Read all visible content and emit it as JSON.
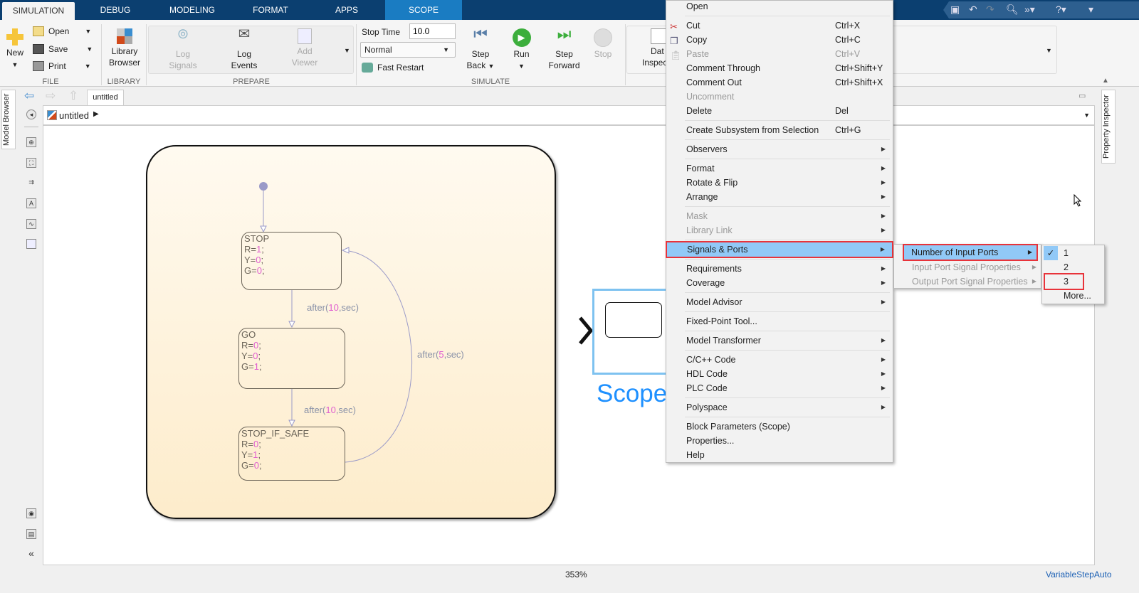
{
  "tabs": [
    {
      "label": "SIMULATION",
      "active": true
    },
    {
      "label": "DEBUG"
    },
    {
      "label": "MODELING"
    },
    {
      "label": "FORMAT"
    },
    {
      "label": "APPS"
    },
    {
      "label": "SCOPE",
      "contextual": true
    }
  ],
  "toolstrip": {
    "file": {
      "label": "FILE",
      "new": "New",
      "open": "Open",
      "save": "Save",
      "print": "Print"
    },
    "library": {
      "label": "LIBRARY",
      "browser_line1": "Library",
      "browser_line2": "Browser"
    },
    "prepare": {
      "label": "PREPARE",
      "log_signals": [
        "Log",
        "Signals"
      ],
      "log_events": [
        "Log",
        "Events"
      ],
      "add_viewer": [
        "Add",
        "Viewer"
      ]
    },
    "simulate": {
      "label": "SIMULATE",
      "stop_time_label": "Stop Time",
      "stop_time_value": "10.0",
      "mode": "Normal",
      "fast_restart": "Fast Restart",
      "step_back": [
        "Step",
        "Back"
      ],
      "run": "Run",
      "step_forward": [
        "Step",
        "Forward"
      ],
      "stop": "Stop"
    },
    "review": {
      "data_inspector": [
        "Dat",
        "Inspec"
      ]
    }
  },
  "nav": {
    "tab": "untitled",
    "breadcrumb": "untitled"
  },
  "side": {
    "model_browser": "Model Browser",
    "property_inspector": "Property Inspector"
  },
  "chart": {
    "states": [
      {
        "name": "STOP",
        "lines": [
          [
            "R=",
            "1",
            ";"
          ],
          [
            "Y=",
            "0",
            ";"
          ],
          [
            "G=",
            "0",
            ";"
          ]
        ]
      },
      {
        "name": "GO",
        "lines": [
          [
            "R=",
            "0",
            ";"
          ],
          [
            "Y=",
            "0",
            ";"
          ],
          [
            "G=",
            "1",
            ";"
          ]
        ]
      },
      {
        "name": "STOP_IF_SAFE",
        "lines": [
          [
            "R=",
            "0",
            ";"
          ],
          [
            "Y=",
            "1",
            ";"
          ],
          [
            "G=",
            "0",
            ";"
          ]
        ]
      }
    ],
    "transitions": [
      [
        "after(",
        "10",
        ",sec)"
      ],
      [
        "after(",
        "10",
        ",sec)"
      ],
      [
        "after(",
        "5",
        ",sec)"
      ]
    ]
  },
  "scope_label": "Scope",
  "context_menu": [
    {
      "label": "Open"
    },
    {
      "sep": true
    },
    {
      "label": "Cut",
      "shortcut": "Ctrl+X",
      "icon": "scissors-icon"
    },
    {
      "label": "Copy",
      "shortcut": "Ctrl+C",
      "icon": "copy-icon"
    },
    {
      "label": "Paste",
      "shortcut": "Ctrl+V",
      "icon": "paste-icon",
      "disabled": true
    },
    {
      "label": "Comment Through",
      "shortcut": "Ctrl+Shift+Y"
    },
    {
      "label": "Comment Out",
      "shortcut": "Ctrl+Shift+X"
    },
    {
      "label": "Uncomment",
      "disabled": true
    },
    {
      "label": "Delete",
      "shortcut": "Del"
    },
    {
      "sep": true
    },
    {
      "label": "Create Subsystem from Selection",
      "shortcut": "Ctrl+G"
    },
    {
      "sep": true
    },
    {
      "label": "Observers",
      "submenu": true
    },
    {
      "sep": true
    },
    {
      "label": "Format",
      "submenu": true
    },
    {
      "label": "Rotate & Flip",
      "submenu": true
    },
    {
      "label": "Arrange",
      "submenu": true
    },
    {
      "sep": true
    },
    {
      "label": "Mask",
      "submenu": true,
      "disabled": true
    },
    {
      "label": "Library Link",
      "submenu": true,
      "disabled": true
    },
    {
      "sep": true
    },
    {
      "label": "Signals & Ports",
      "submenu": true,
      "highlighted": true
    },
    {
      "sep": true
    },
    {
      "label": "Requirements",
      "submenu": true
    },
    {
      "label": "Coverage",
      "submenu": true
    },
    {
      "sep": true
    },
    {
      "label": "Model Advisor",
      "submenu": true
    },
    {
      "sep": true
    },
    {
      "label": "Fixed-Point Tool..."
    },
    {
      "sep": true
    },
    {
      "label": "Model Transformer",
      "submenu": true
    },
    {
      "sep": true
    },
    {
      "label": "C/C++ Code",
      "submenu": true
    },
    {
      "label": "HDL Code",
      "submenu": true
    },
    {
      "label": "PLC Code",
      "submenu": true
    },
    {
      "sep": true
    },
    {
      "label": "Polyspace",
      "submenu": true
    },
    {
      "sep": true
    },
    {
      "label": "Block Parameters (Scope)"
    },
    {
      "label": "Properties..."
    },
    {
      "label": "Help"
    }
  ],
  "submenu": [
    {
      "label": "Number of Input Ports",
      "highlighted": true
    },
    {
      "label": "Input Port Signal Properties",
      "disabled": true
    },
    {
      "label": "Output Port Signal Properties",
      "disabled": true
    }
  ],
  "port_options": [
    {
      "label": "1",
      "checked": true
    },
    {
      "label": "2"
    },
    {
      "label": "3",
      "outlined": true
    },
    {
      "label": "More..."
    }
  ],
  "status": {
    "zoom": "353%",
    "solver": "VariableStepAuto"
  },
  "colors": {
    "titlebar": "#0b3f70",
    "scope_tab": "#1a7cc2",
    "menu_highlight": "#91c9f7",
    "annotation_red": "#e8333a",
    "scope_label": "#1e90ff"
  }
}
